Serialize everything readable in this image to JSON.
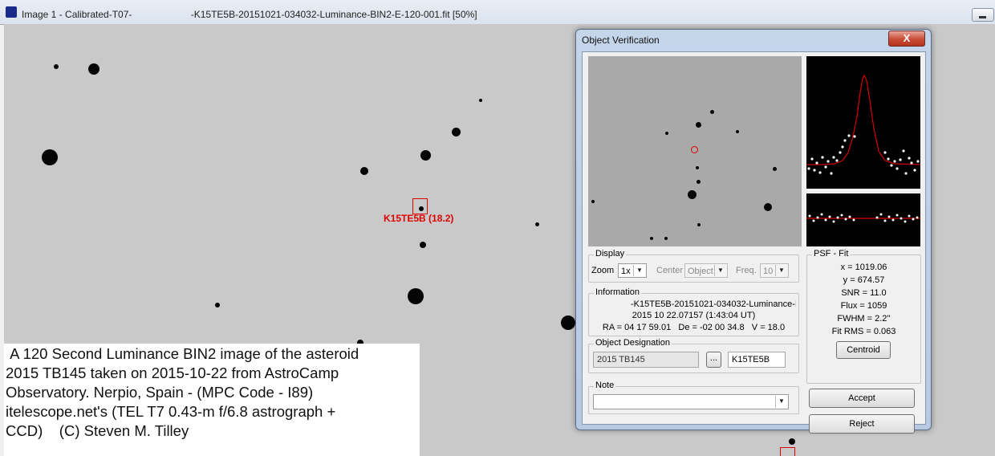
{
  "window": {
    "title": "Image 1 - Calibrated-T07-                      -K15TE5B-20151021-034032-Luminance-BIN2-E-120-001.fit [50%]"
  },
  "image": {
    "object_label": "K15TE5B (18.2)"
  },
  "caption": {
    "text": " A 120 Second Luminance BIN2 image of the asteroid\n2015 TB145 taken on 2015-10-22 from AstroCamp\nObservatory. Nerpio, Spain - (MPC Code - I89)\nitelescope.net's (TEL T7 0.43-m f/6.8 astrograph +\nCCD)    (C) Steven M. Tilley"
  },
  "dialog": {
    "title": "Object Verification",
    "close_glyph": "X",
    "display": {
      "legend": "Display",
      "zoom_label": "Zoom",
      "zoom_value": "1x",
      "center_label": "Center",
      "center_value": "Object",
      "freq_label": "Freq.",
      "freq_value": "10"
    },
    "information": {
      "legend": "Information",
      "line1": "-K15TE5B-20151021-034032-Luminance-I",
      "line2": "2015 10 22.07157 (1:43:04 UT)",
      "line3": "RA = 04 17 59.01   De = -02 00 34.8   V = 18.0"
    },
    "designation": {
      "legend": "Object Designation",
      "designation_value": "2015 TB145",
      "browse_label": "...",
      "code_value": "K15TE5B"
    },
    "note": {
      "legend": "Note",
      "value": ""
    },
    "psf": {
      "legend": "PSF - Fit",
      "x": "x = 1019.06",
      "y": "y = 674.57",
      "snr": "SNR = 11.0",
      "flux": "Flux = 1059",
      "fwhm": "FWHM = 2.2''",
      "fit_rms": "Fit RMS = 0.063",
      "centroid_label": "Centroid"
    },
    "buttons": {
      "accept": "Accept",
      "reject": "Reject"
    }
  },
  "colors": {
    "marker": "#dd0000",
    "fit_line": "#d40000",
    "dialog_frame": "#b8c9e2"
  }
}
